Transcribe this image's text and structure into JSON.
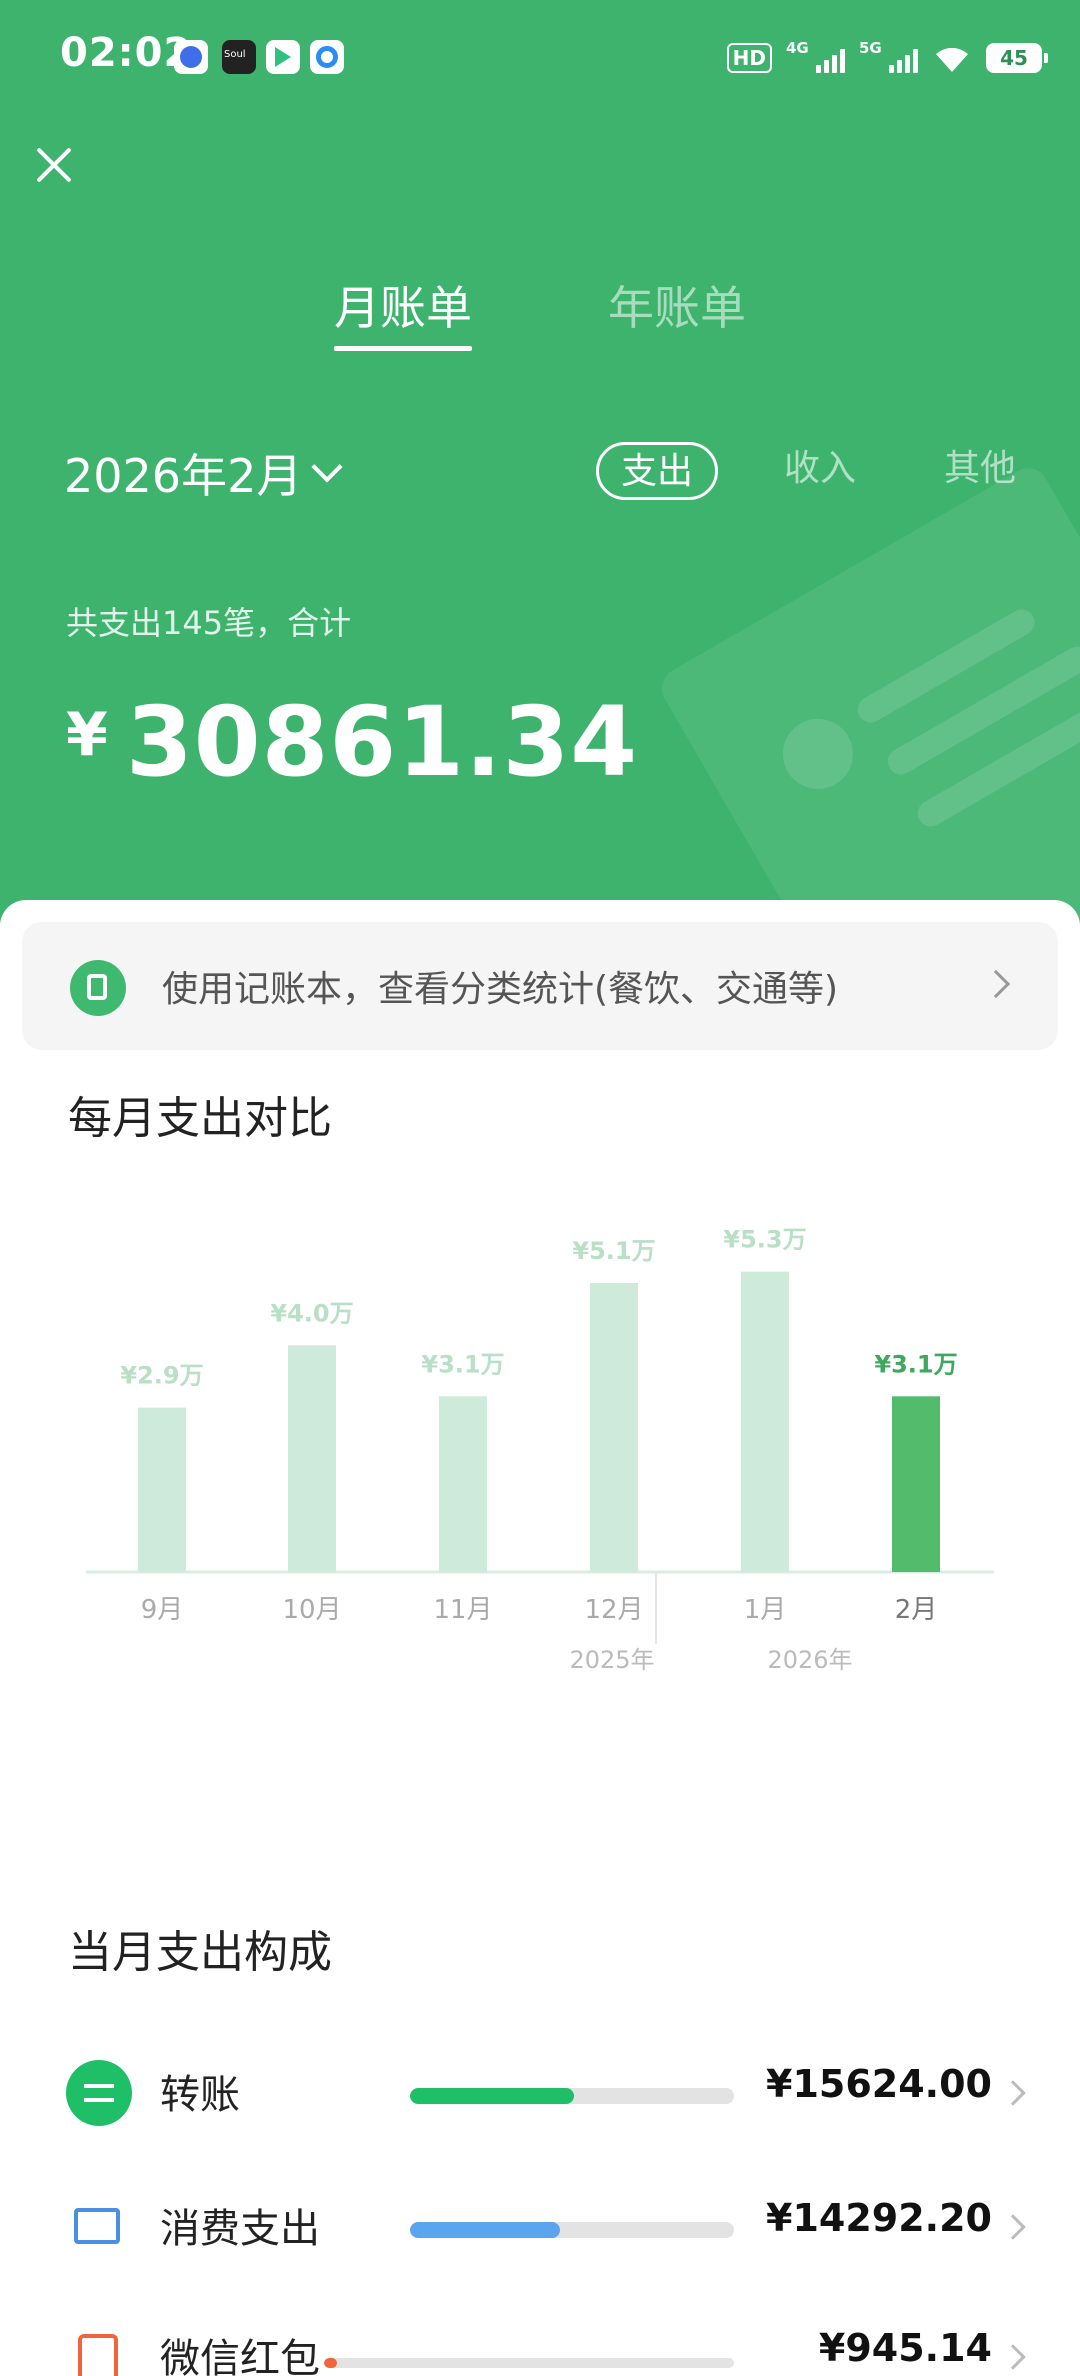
{
  "status_bar": {
    "time": "02:02",
    "hd_label": "HD",
    "net1": "4G",
    "net2": "5G",
    "battery": "45"
  },
  "header": {
    "tabs": [
      {
        "label": "月账单",
        "active": true
      },
      {
        "label": "年账单",
        "active": false
      }
    ],
    "date": "2026年2月",
    "type_tabs": [
      {
        "label": "支出",
        "active": true
      },
      {
        "label": "收入",
        "active": false
      },
      {
        "label": "其他",
        "active": false
      }
    ],
    "summary_label": "共支出145笔，合计",
    "currency_symbol": "¥",
    "total": "30861.34"
  },
  "ledger_banner": {
    "text": "使用记账本，查看分类统计(餐饮、交通等)"
  },
  "monthly_compare": {
    "title": "每月支出对比"
  },
  "chart_data": {
    "type": "bar",
    "categories": [
      "9月",
      "10月",
      "11月",
      "12月",
      "1月",
      "2月"
    ],
    "values": [
      2.9,
      4.0,
      3.1,
      5.1,
      5.3,
      3.1
    ],
    "value_labels": [
      "¥2.9万",
      "¥4.0万",
      "¥3.1万",
      "¥5.1万",
      "¥5.3万",
      "¥3.1万"
    ],
    "year_labels": [
      "2025年",
      "2026年"
    ],
    "highlight_index": 5,
    "ylim": [
      0,
      6
    ],
    "colors": {
      "bar": "#cdeada",
      "highlight": "#52bb6c",
      "label": "#b9dfc7",
      "highlight_label": "#3fa85e"
    }
  },
  "composition": {
    "title": "当月支出构成",
    "items": [
      {
        "label": "转账",
        "amount": "¥15624.00",
        "fraction": 0.506,
        "color": "#1fbf68",
        "icon": "transfer-icon"
      },
      {
        "label": "消费支出",
        "amount": "¥14292.20",
        "fraction": 0.463,
        "color": "#5ba4f0",
        "icon": "wallet-icon"
      },
      {
        "label": "微信红包",
        "amount": "¥945.14",
        "fraction": 0.031,
        "color": "#f0653c",
        "icon": "red-packet-icon"
      }
    ]
  }
}
